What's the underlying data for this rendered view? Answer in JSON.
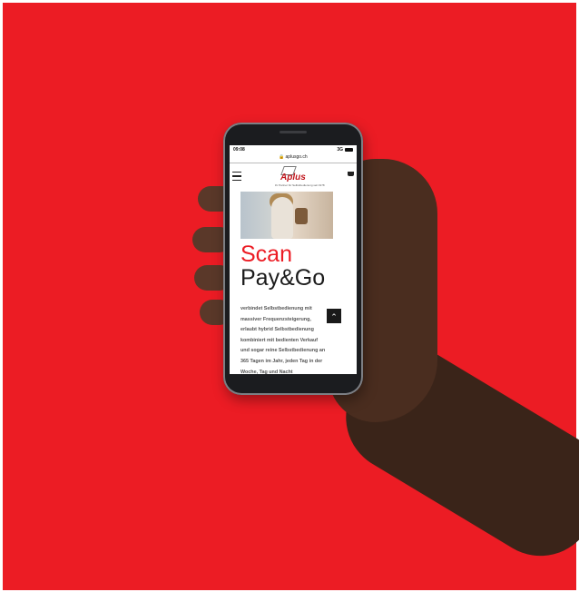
{
  "status_bar": {
    "time": "09:08",
    "network": "3G"
  },
  "browser": {
    "url": "aplusgo.ch"
  },
  "site": {
    "logo_text": "Aplus",
    "logo_subtitle": "ihr Partner für Selbstbedienung seit 1978"
  },
  "hero": {
    "title_line1": "Scan",
    "title_line2": "Pay&Go",
    "body_lines": [
      "verbindet Selbstbedienung mit",
      "massiver Frequenzsteigerung,",
      "erlaubt hybrid Selbstbedienung",
      "kombiniert mit bedienten Verkauf",
      "und sogar reine Selbstbedienung an",
      "365 Tagen im Jahr, jeden Tag in der",
      "Woche, Tag und Nacht"
    ]
  },
  "icons": {
    "menu": "hamburger-menu-icon",
    "cart": "shopping-cart-icon",
    "scroll_top": "chevron-up-icon",
    "lock": "lock-icon"
  },
  "colors": {
    "background": "#ec1c24",
    "accent": "#ec1c24",
    "text_dark": "#1b1b1b"
  }
}
